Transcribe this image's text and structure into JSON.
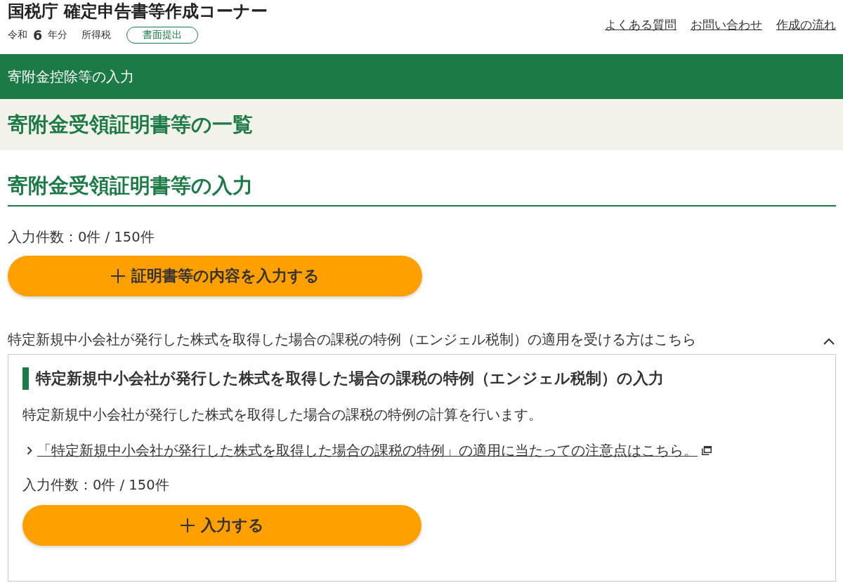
{
  "header": {
    "title": "国税庁 確定申告書等作成コーナー",
    "era": "令和",
    "year": "6",
    "year_suffix": "年分",
    "tax_type": "所得税",
    "badge": "書面提出",
    "links": [
      "よくある質問",
      "お問い合わせ",
      "作成の流れ"
    ]
  },
  "step_bar": {
    "title": "寄附金控除等の入力"
  },
  "page_title": "寄附金受領証明書等の一覧",
  "section": {
    "heading": "寄附金受領証明書等の入力",
    "count": "入力件数：0件 / 150件",
    "button": "証明書等の内容を入力する"
  },
  "accordion": {
    "title": "特定新規中小会社が発行した株式を取得した場合の課税の特例（エンジェル税制）の適用を受ける方はこちら",
    "expanded": true,
    "panel": {
      "heading": "特定新規中小会社が発行した株式を取得した場合の課税の特例（エンジェル税制）の入力",
      "description": "特定新規中小会社が発行した株式を取得した場合の課税の特例の計算を行います。",
      "link": "「特定新規中小会社が発行した株式を取得した場合の課税の特例」の適用に当たっての注意点はこちら。",
      "count": "入力件数：0件 / 150件",
      "button": "入力する"
    }
  }
}
